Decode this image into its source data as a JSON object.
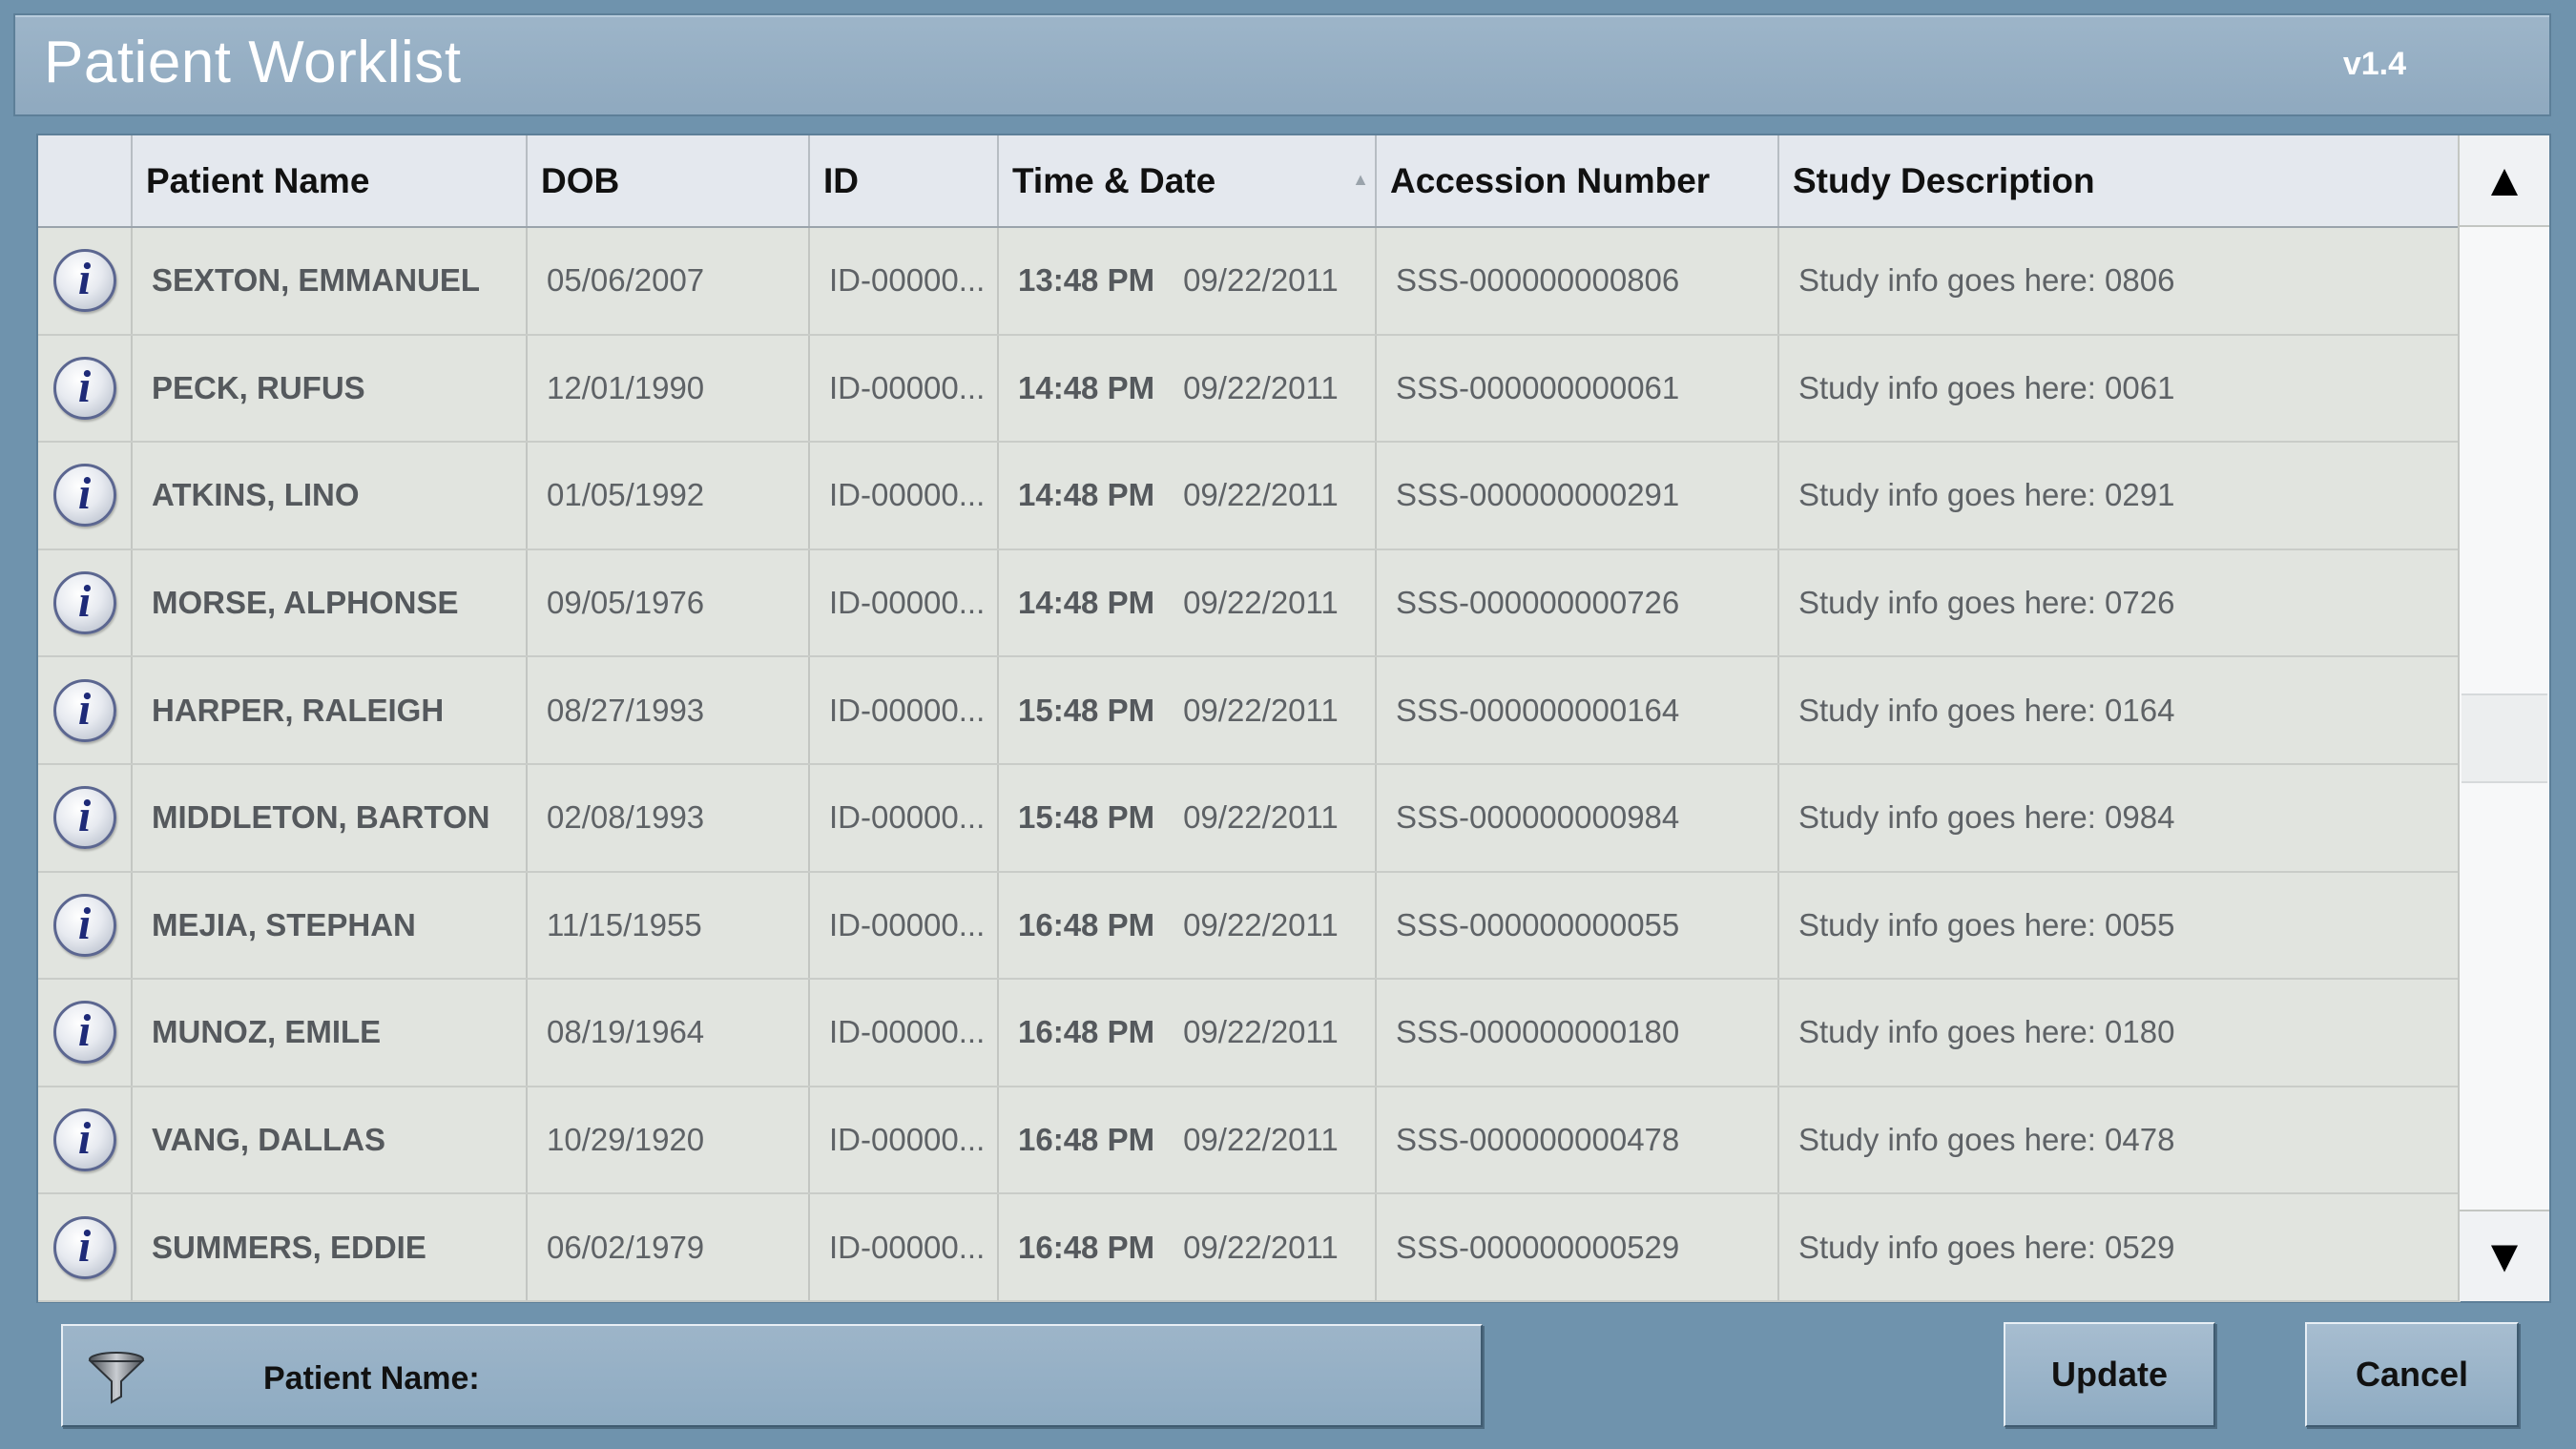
{
  "header": {
    "title": "Patient Worklist",
    "version": "v1.4"
  },
  "table": {
    "columns": [
      "",
      "Patient Name",
      "DOB",
      "ID",
      "Time & Date",
      "Accession Number",
      "Study Description"
    ],
    "sorted_column": "Time & Date",
    "rows": [
      {
        "name": "SEXTON, EMMANUEL",
        "dob": "05/06/2007",
        "id": "ID-00000...",
        "time": "13:48 PM",
        "date": "09/22/2011",
        "accession": "SSS-000000000806",
        "study": "Study info goes here: 0806"
      },
      {
        "name": "PECK, RUFUS",
        "dob": "12/01/1990",
        "id": "ID-00000...",
        "time": "14:48 PM",
        "date": "09/22/2011",
        "accession": "SSS-000000000061",
        "study": "Study info goes here: 0061"
      },
      {
        "name": "ATKINS, LINO",
        "dob": "01/05/1992",
        "id": "ID-00000...",
        "time": "14:48 PM",
        "date": "09/22/2011",
        "accession": "SSS-000000000291",
        "study": "Study info goes here: 0291"
      },
      {
        "name": "MORSE, ALPHONSE",
        "dob": "09/05/1976",
        "id": "ID-00000...",
        "time": "14:48 PM",
        "date": "09/22/2011",
        "accession": "SSS-000000000726",
        "study": "Study info goes here: 0726"
      },
      {
        "name": "HARPER, RALEIGH",
        "dob": "08/27/1993",
        "id": "ID-00000...",
        "time": "15:48 PM",
        "date": "09/22/2011",
        "accession": "SSS-000000000164",
        "study": "Study info goes here: 0164"
      },
      {
        "name": "MIDDLETON, BARTON",
        "dob": "02/08/1993",
        "id": "ID-00000...",
        "time": "15:48 PM",
        "date": "09/22/2011",
        "accession": "SSS-000000000984",
        "study": "Study info goes here: 0984"
      },
      {
        "name": "MEJIA, STEPHAN",
        "dob": "11/15/1955",
        "id": "ID-00000...",
        "time": "16:48 PM",
        "date": "09/22/2011",
        "accession": "SSS-000000000055",
        "study": "Study info goes here: 0055"
      },
      {
        "name": "MUNOZ, EMILE",
        "dob": "08/19/1964",
        "id": "ID-00000...",
        "time": "16:48 PM",
        "date": "09/22/2011",
        "accession": "SSS-000000000180",
        "study": "Study info goes here: 0180"
      },
      {
        "name": "VANG, DALLAS",
        "dob": "10/29/1920",
        "id": "ID-00000...",
        "time": "16:48 PM",
        "date": "09/22/2011",
        "accession": "SSS-000000000478",
        "study": "Study info goes here: 0478"
      },
      {
        "name": "SUMMERS, EDDIE",
        "dob": "06/02/1979",
        "id": "ID-00000...",
        "time": "16:48 PM",
        "date": "09/22/2011",
        "accession": "SSS-000000000529",
        "study": "Study info goes here: 0529"
      }
    ]
  },
  "scrollbar": {
    "up_icon": "triangle-up-icon",
    "down_icon": "triangle-down-icon"
  },
  "filter": {
    "icon": "funnel-icon",
    "label": "Patient Name:",
    "value": ""
  },
  "buttons": {
    "update": "Update",
    "cancel": "Cancel"
  },
  "colors": {
    "background": "#6f93ad",
    "titlebar": "#9db5c9",
    "row": "#e1e4df",
    "header": "#e4e8ee",
    "info_icon": "#1e2a78"
  }
}
